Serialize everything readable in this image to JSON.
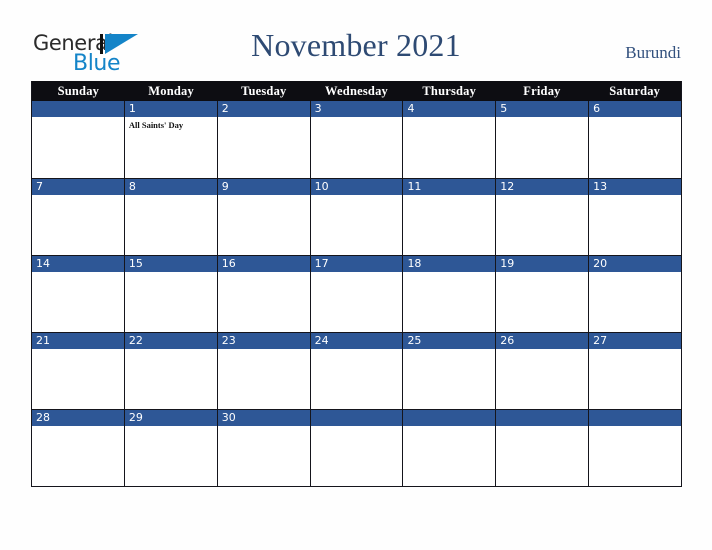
{
  "brand": {
    "name_part1": "General",
    "name_part2": "Blue",
    "mark_icon": "triangle-logo-icon",
    "accent_color": "#1484c8"
  },
  "header": {
    "title": "November 2021",
    "country": "Burundi",
    "title_color": "#2e4a73"
  },
  "calendar": {
    "month": "November",
    "year": "2021",
    "weekday_headers": [
      "Sunday",
      "Monday",
      "Tuesday",
      "Wednesday",
      "Thursday",
      "Friday",
      "Saturday"
    ],
    "header_bg_color": "#0d0d12",
    "date_band_color": "#2e5796",
    "weeks": [
      [
        {
          "date": "",
          "events": []
        },
        {
          "date": "1",
          "events": [
            "All Saints' Day"
          ]
        },
        {
          "date": "2",
          "events": []
        },
        {
          "date": "3",
          "events": []
        },
        {
          "date": "4",
          "events": []
        },
        {
          "date": "5",
          "events": []
        },
        {
          "date": "6",
          "events": []
        }
      ],
      [
        {
          "date": "7",
          "events": []
        },
        {
          "date": "8",
          "events": []
        },
        {
          "date": "9",
          "events": []
        },
        {
          "date": "10",
          "events": []
        },
        {
          "date": "11",
          "events": []
        },
        {
          "date": "12",
          "events": []
        },
        {
          "date": "13",
          "events": []
        }
      ],
      [
        {
          "date": "14",
          "events": []
        },
        {
          "date": "15",
          "events": []
        },
        {
          "date": "16",
          "events": []
        },
        {
          "date": "17",
          "events": []
        },
        {
          "date": "18",
          "events": []
        },
        {
          "date": "19",
          "events": []
        },
        {
          "date": "20",
          "events": []
        }
      ],
      [
        {
          "date": "21",
          "events": []
        },
        {
          "date": "22",
          "events": []
        },
        {
          "date": "23",
          "events": []
        },
        {
          "date": "24",
          "events": []
        },
        {
          "date": "25",
          "events": []
        },
        {
          "date": "26",
          "events": []
        },
        {
          "date": "27",
          "events": []
        }
      ],
      [
        {
          "date": "28",
          "events": []
        },
        {
          "date": "29",
          "events": []
        },
        {
          "date": "30",
          "events": []
        },
        {
          "date": "",
          "events": []
        },
        {
          "date": "",
          "events": []
        },
        {
          "date": "",
          "events": []
        },
        {
          "date": "",
          "events": []
        }
      ]
    ]
  }
}
